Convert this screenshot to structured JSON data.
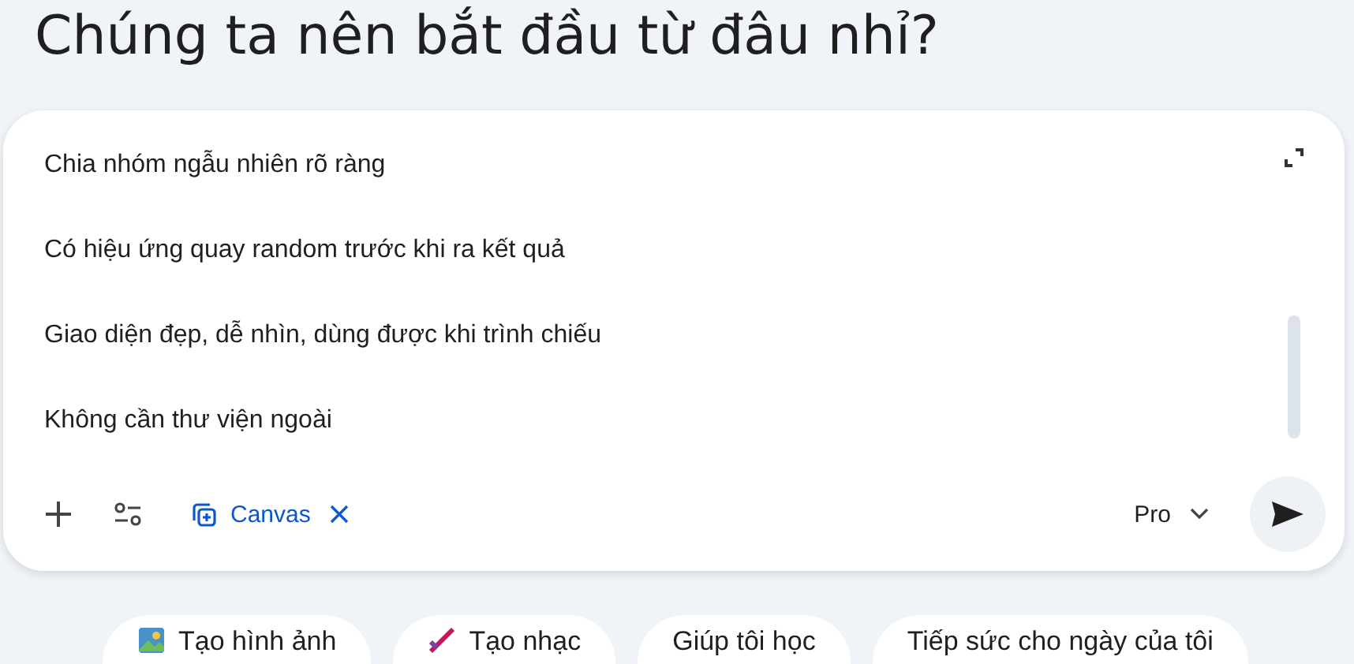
{
  "heading": "Chúng ta nên bắt đầu từ đâu nhỉ?",
  "prompt": {
    "lines": [
      "Chia nhóm ngẫu nhiên rõ ràng",
      "Có hiệu ứng quay random trước khi ra kết quả",
      "Giao diện đẹp, dễ nhìn, dùng được khi trình chiếu",
      "Không cần thư viện ngoài"
    ],
    "tool_chip": {
      "label": "Canvas"
    },
    "model": "Pro"
  },
  "suggestions": [
    {
      "label": "Tạo hình ảnh",
      "kind": "image"
    },
    {
      "label": "Tạo nhạc",
      "kind": "music"
    },
    {
      "label": "Giúp tôi học",
      "kind": "none"
    },
    {
      "label": "Tiếp sức cho ngày của tôi",
      "kind": "none"
    }
  ]
}
